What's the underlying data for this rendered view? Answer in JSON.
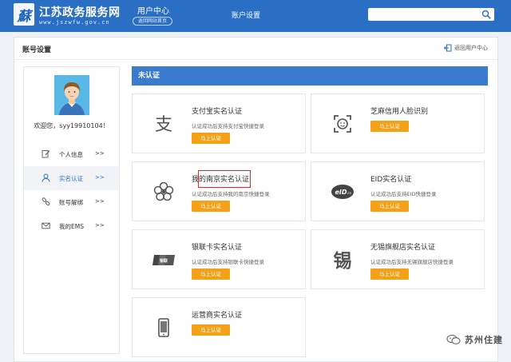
{
  "header": {
    "logo_char": "蘇",
    "brand_title": "江苏政务服务网",
    "brand_url": "www.jszwfw.gov.cn",
    "user_center_title": "用户中心",
    "back_to_portal": "返回网站首页",
    "nav_account_settings": "账户设置",
    "search_placeholder": ""
  },
  "page": {
    "title": "账号设置",
    "back_link": "返回用户中心"
  },
  "sidebar": {
    "welcome": "欢迎您，syy19910104！",
    "items": [
      {
        "label": "个人信息",
        "arrow": ">>",
        "icon": "edit-icon",
        "active": false
      },
      {
        "label": "实名认证",
        "arrow": ">>",
        "icon": "user-icon",
        "active": true
      },
      {
        "label": "账号解绑",
        "arrow": ">>",
        "icon": "unlink-icon",
        "active": false
      },
      {
        "label": "我的EMS",
        "arrow": ">>",
        "icon": "mail-icon",
        "active": false
      }
    ]
  },
  "status": "未认证",
  "tiles": [
    {
      "title": "支付宝实名认证",
      "desc": "认证成功后支持支付宝快捷登录",
      "button": "马上认证",
      "icon": "alipay-icon"
    },
    {
      "title": "芝麻信用人脸识别",
      "desc": "",
      "button": "马上认证",
      "icon": "face-scan-icon"
    },
    {
      "title": "我的南京实名认证",
      "desc": "认证成功后支持我的南京快捷登录",
      "button": "马上认证",
      "icon": "nanjing-flower-icon"
    },
    {
      "title": "EID实名认证",
      "desc": "认证成功后支持EID快捷登录",
      "button": "马上认证",
      "icon": "eid-icon"
    },
    {
      "title": "银联卡实名认证",
      "desc": "认证成功后支持银联卡快捷登录",
      "button": "马上认证",
      "icon": "unionpay-icon"
    },
    {
      "title": "无锡旗舰店实名认证",
      "desc": "认证成功后支持无锡旗舰店快捷登录",
      "button": "马上认证",
      "icon": "wuxi-icon"
    },
    {
      "title": "运营商实名认证",
      "desc": "",
      "button": "马上认证",
      "icon": "phone-icon"
    }
  ],
  "watermark": "苏州住建",
  "colors": {
    "header_blue": "#2a6fc4",
    "status_blue": "#3a7bd0",
    "button_orange": "#f4a118",
    "highlight_red": "#e0262a"
  }
}
